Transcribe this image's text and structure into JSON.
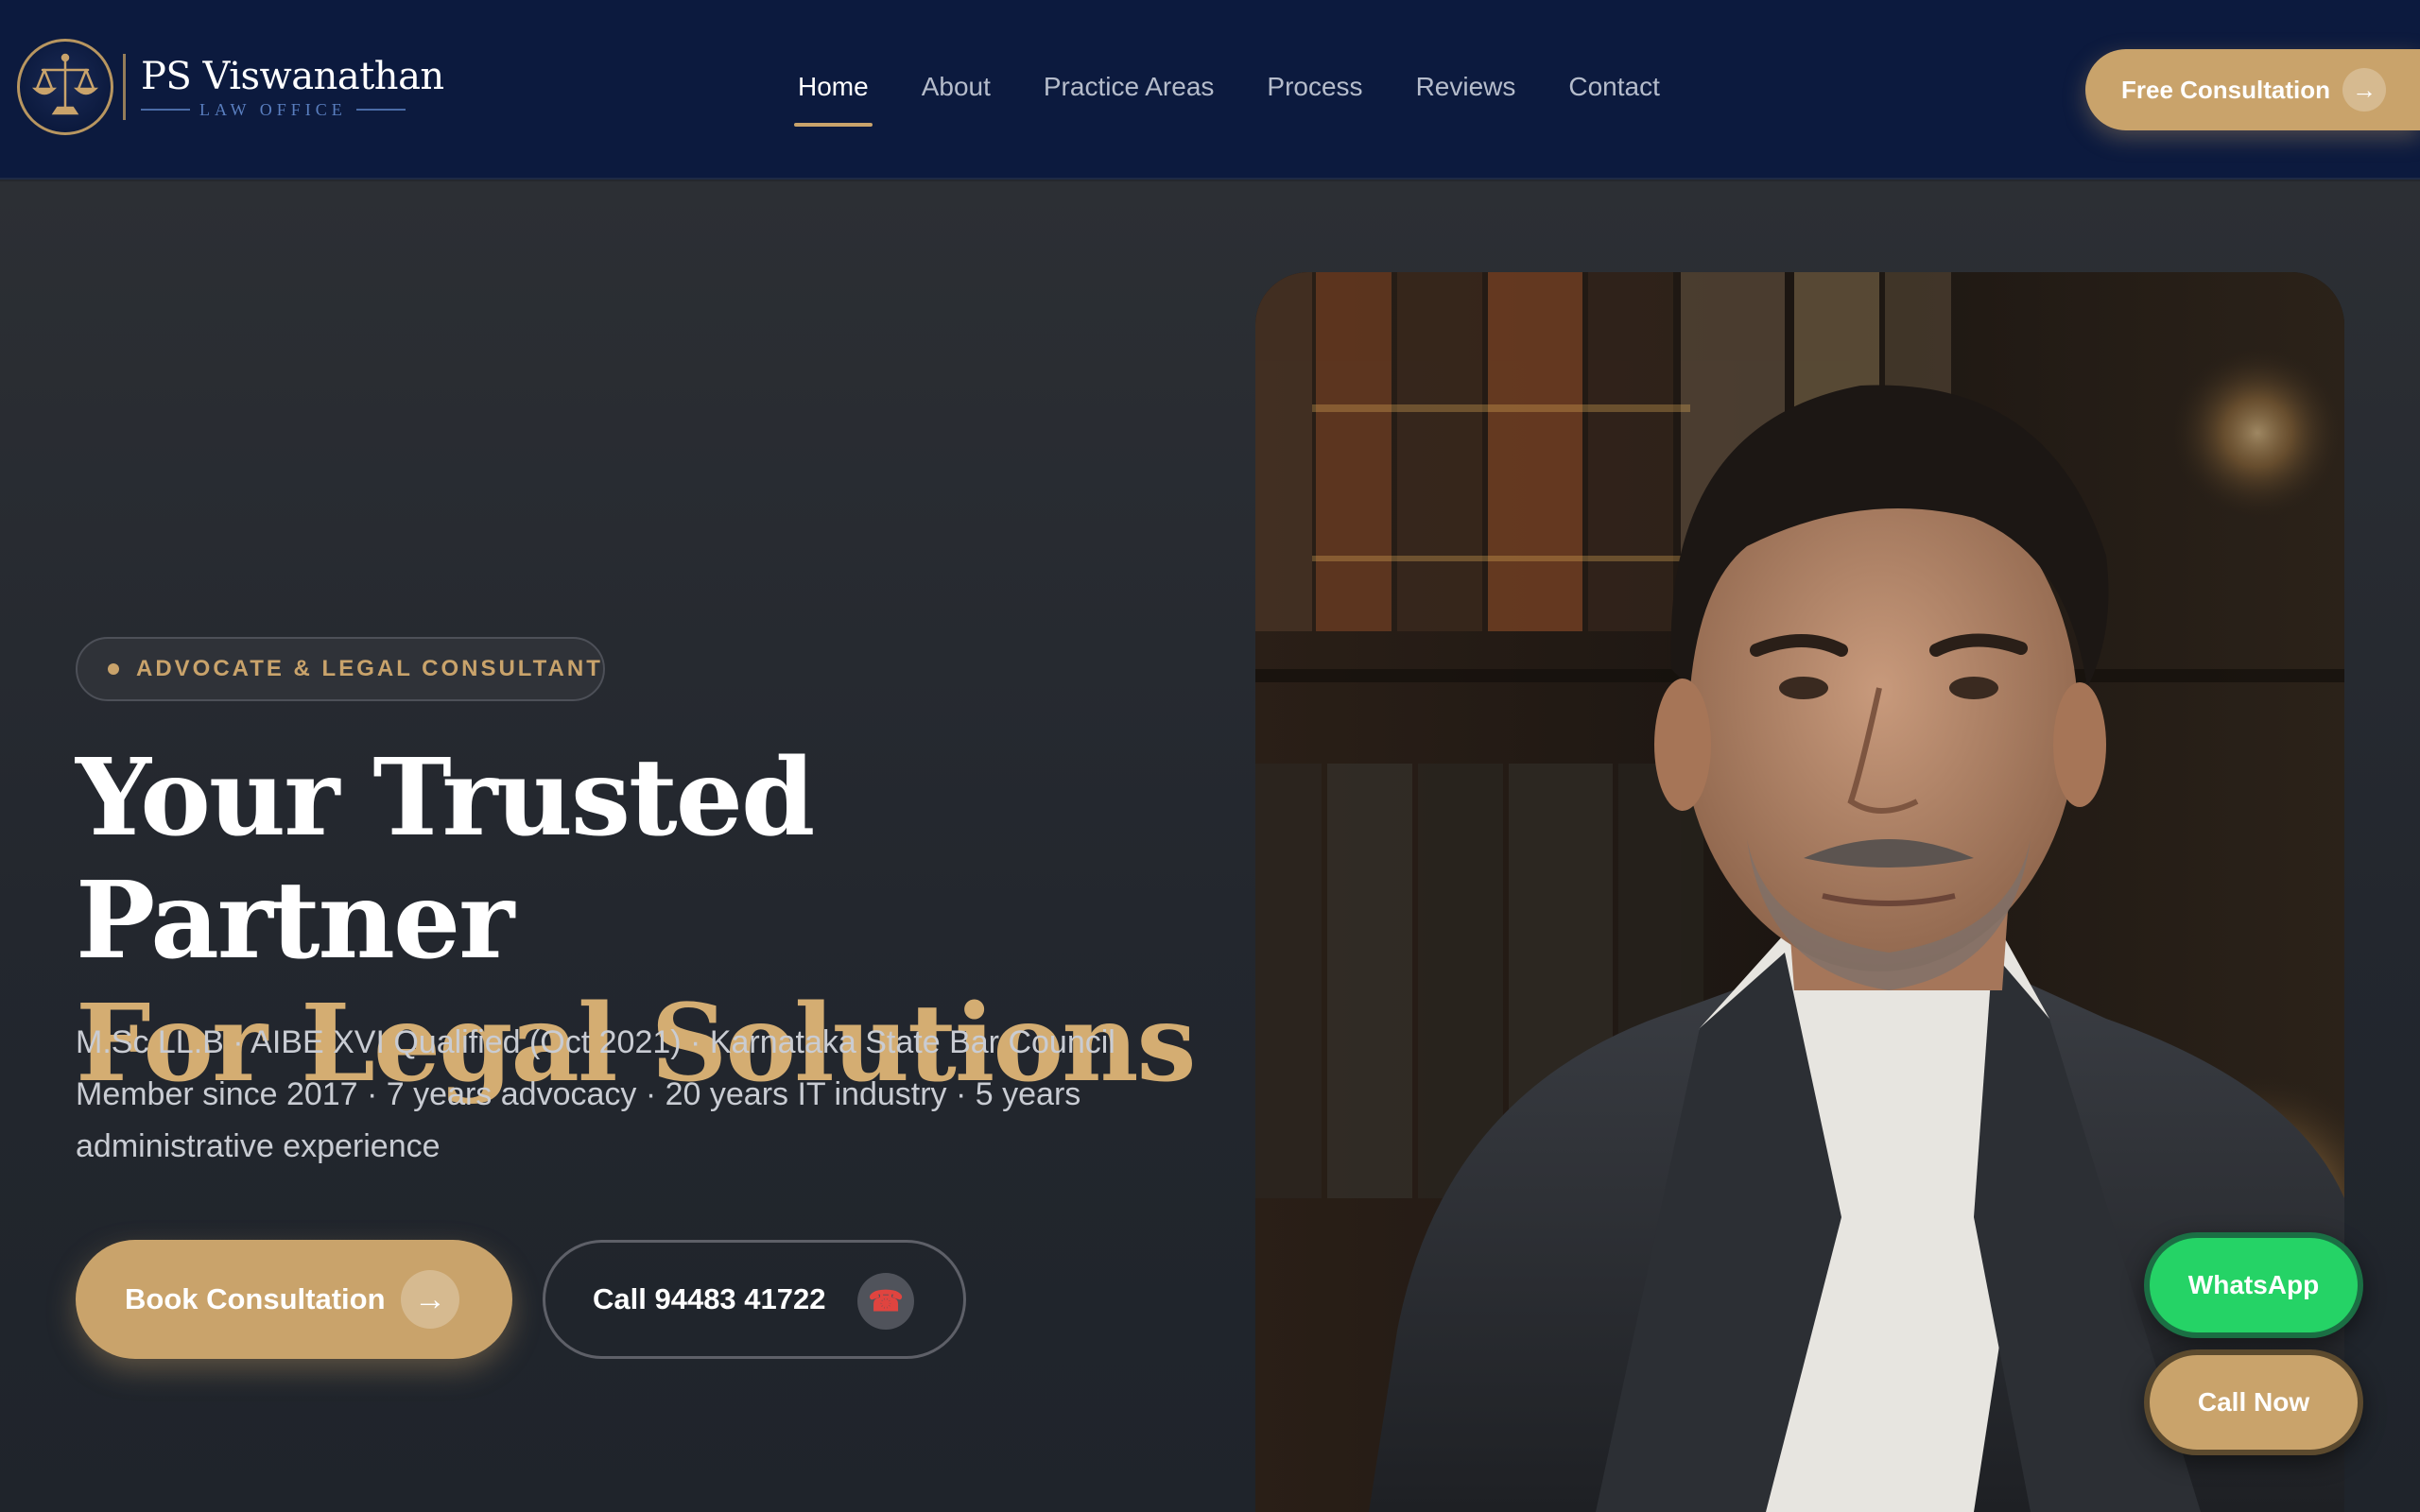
{
  "brand": {
    "name": "PS Viswanathan",
    "subtitle": "LAW OFFICE",
    "icon": "scales-of-justice-icon"
  },
  "nav": {
    "items": [
      {
        "label": "Home",
        "active": true
      },
      {
        "label": "About",
        "active": false
      },
      {
        "label": "Practice Areas",
        "active": false
      },
      {
        "label": "Process",
        "active": false
      },
      {
        "label": "Reviews",
        "active": false
      },
      {
        "label": "Contact",
        "active": false
      }
    ]
  },
  "header_cta": {
    "label": "Free Consultation",
    "icon": "arrow-right-icon",
    "arrow": "→"
  },
  "hero": {
    "badge": "ADVOCATE & LEGAL CONSULTANT",
    "headline_line1": "Your Trusted Partner",
    "headline_line2": "For Legal Solutions",
    "description": "M.Sc LL.B · AIBE XVI Qualified (Oct 2021) · Karnataka State Bar Council Member since 2017 · 7 years advocacy · 20 years IT industry · 5 years administrative experience",
    "primary_button": {
      "label": "Book Consultation",
      "arrow": "→"
    },
    "secondary_button": {
      "label": "Call 94483 41722",
      "icon": "phone-icon",
      "glyph": "☎"
    }
  },
  "floating": {
    "whatsapp": "WhatsApp",
    "call": "Call Now"
  },
  "colors": {
    "header_bg": "#0c1a3e",
    "hero_bg": "#25282d",
    "gold": "#c9a36b",
    "headline_gold": "#d4ad72",
    "whatsapp_green": "#25d366"
  }
}
